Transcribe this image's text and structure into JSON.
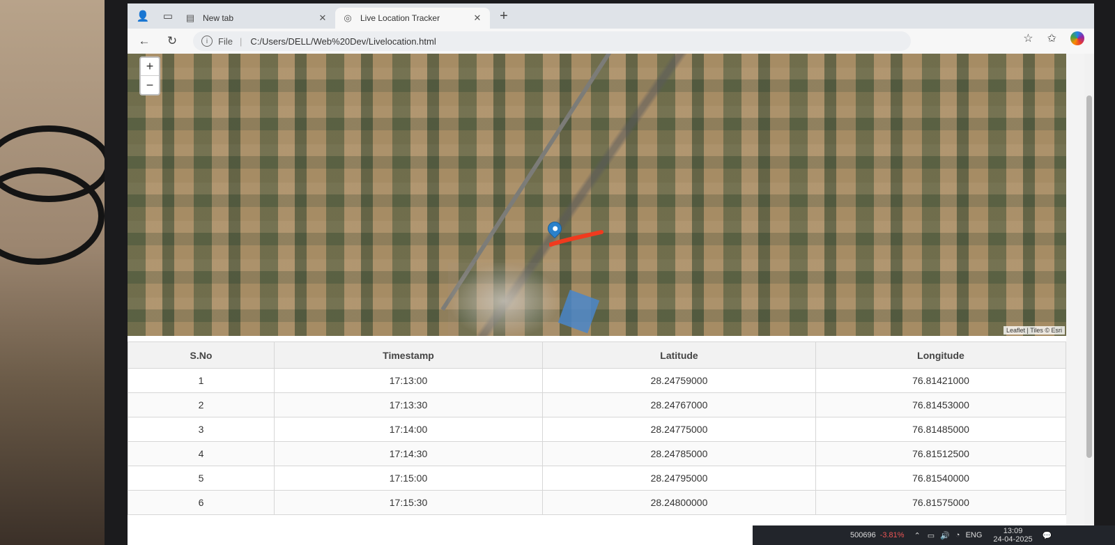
{
  "browser": {
    "tabs": [
      {
        "title": "New tab",
        "icon": "new-tab-page-icon",
        "active": false
      },
      {
        "title": "Live Location Tracker",
        "icon": "globe-icon",
        "active": true
      }
    ],
    "address": {
      "scheme_label": "File",
      "url": "C:/Users/DELL/Web%20Dev/Livelocation.html"
    }
  },
  "map": {
    "zoom_in": "+",
    "zoom_out": "−",
    "attribution": "Leaflet | Tiles © Esri",
    "track_color": "#f03a1e",
    "marker_color": "#2a81cb"
  },
  "table": {
    "headers": [
      "S.No",
      "Timestamp",
      "Latitude",
      "Longitude"
    ],
    "rows": [
      [
        "1",
        "17:13:00",
        "28.24759000",
        "76.81421000"
      ],
      [
        "2",
        "17:13:30",
        "28.24767000",
        "76.81453000"
      ],
      [
        "3",
        "17:14:00",
        "28.24775000",
        "76.81485000"
      ],
      [
        "4",
        "17:14:30",
        "28.24785000",
        "76.81512500"
      ],
      [
        "5",
        "17:15:00",
        "28.24795000",
        "76.81540000"
      ],
      [
        "6",
        "17:15:30",
        "28.24800000",
        "76.81575000"
      ]
    ]
  },
  "taskbar": {
    "ticker": "500696",
    "change": "-3.81%",
    "language": "ENG",
    "time": "13:09",
    "date": "24-04-2025"
  }
}
